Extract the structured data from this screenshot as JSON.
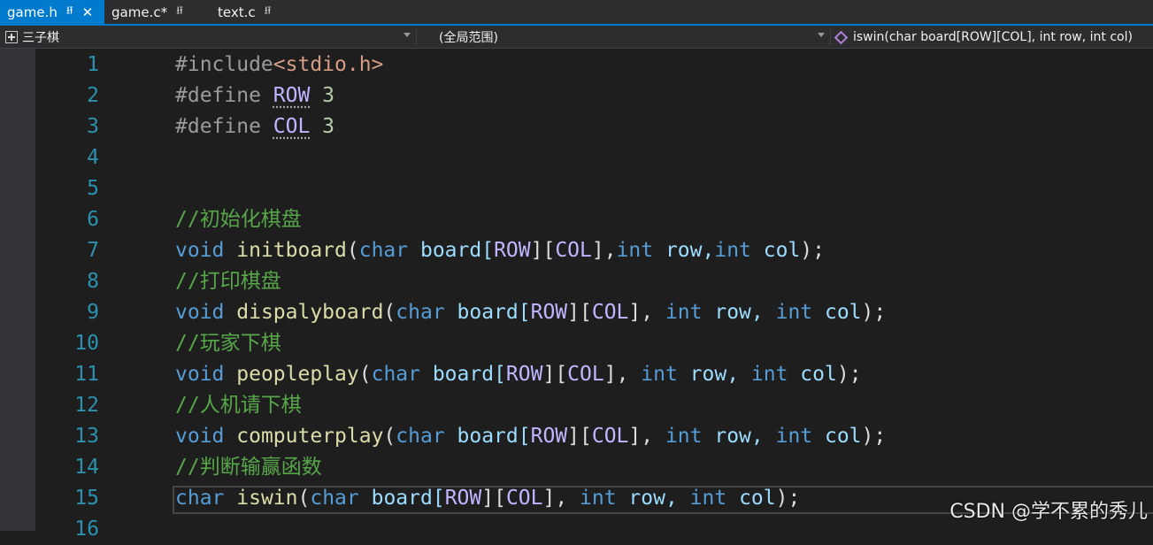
{
  "tabs": [
    {
      "label": "game.h",
      "pin": "⭿",
      "close": "✕",
      "active": true
    },
    {
      "label": "game.c*",
      "pin": "⭿",
      "active": false
    },
    {
      "label": "text.c",
      "pin": "⭿",
      "active": false
    }
  ],
  "nav": {
    "project": "三子棋",
    "scope": "(全局范围)",
    "member": "iswin(char board[ROW][COL], int row, int col)"
  },
  "editor": {
    "current_line": 15,
    "lines": [
      {
        "n": "1",
        "tokens": [
          {
            "t": "#include",
            "c": "pp"
          },
          {
            "t": "<stdio.h>",
            "c": "inc"
          }
        ]
      },
      {
        "n": "2",
        "tokens": [
          {
            "t": "#define ",
            "c": "pp"
          },
          {
            "t": "ROW",
            "c": "mac dot"
          },
          {
            "t": " 3",
            "c": "num"
          }
        ]
      },
      {
        "n": "3",
        "tokens": [
          {
            "t": "#define ",
            "c": "pp"
          },
          {
            "t": "COL",
            "c": "mac dot"
          },
          {
            "t": " 3",
            "c": "num"
          }
        ]
      },
      {
        "n": "4",
        "tokens": []
      },
      {
        "n": "5",
        "tokens": []
      },
      {
        "n": "6",
        "tokens": [
          {
            "t": "//初始化棋盘",
            "c": "cmt"
          }
        ]
      },
      {
        "n": "7",
        "tokens": [
          {
            "t": "void",
            "c": "kw"
          },
          {
            "t": " ",
            "c": "txt"
          },
          {
            "t": "initboard",
            "c": "fn"
          },
          {
            "t": "(",
            "c": "txt"
          },
          {
            "t": "char",
            "c": "kw"
          },
          {
            "t": " board[",
            "c": "par"
          },
          {
            "t": "ROW",
            "c": "mac"
          },
          {
            "t": "][",
            "c": "txt"
          },
          {
            "t": "COL",
            "c": "mac"
          },
          {
            "t": "],",
            "c": "txt"
          },
          {
            "t": "int",
            "c": "kw"
          },
          {
            "t": " row,",
            "c": "par"
          },
          {
            "t": "int",
            "c": "kw"
          },
          {
            "t": " col",
            "c": "par"
          },
          {
            "t": ");",
            "c": "txt"
          }
        ]
      },
      {
        "n": "8",
        "tokens": [
          {
            "t": "//打印棋盘",
            "c": "cmt"
          }
        ]
      },
      {
        "n": "9",
        "tokens": [
          {
            "t": "void",
            "c": "kw"
          },
          {
            "t": " ",
            "c": "txt"
          },
          {
            "t": "dispalyboard",
            "c": "fn"
          },
          {
            "t": "(",
            "c": "txt"
          },
          {
            "t": "char",
            "c": "kw"
          },
          {
            "t": " board[",
            "c": "par"
          },
          {
            "t": "ROW",
            "c": "mac"
          },
          {
            "t": "][",
            "c": "txt"
          },
          {
            "t": "COL",
            "c": "mac"
          },
          {
            "t": "], ",
            "c": "txt"
          },
          {
            "t": "int",
            "c": "kw"
          },
          {
            "t": " row, ",
            "c": "par"
          },
          {
            "t": "int",
            "c": "kw"
          },
          {
            "t": " col",
            "c": "par"
          },
          {
            "t": ");",
            "c": "txt"
          }
        ]
      },
      {
        "n": "10",
        "tokens": [
          {
            "t": "//玩家下棋",
            "c": "cmt"
          }
        ]
      },
      {
        "n": "11",
        "tokens": [
          {
            "t": "void",
            "c": "kw"
          },
          {
            "t": " ",
            "c": "txt"
          },
          {
            "t": "peopleplay",
            "c": "fn"
          },
          {
            "t": "(",
            "c": "txt"
          },
          {
            "t": "char",
            "c": "kw"
          },
          {
            "t": " board[",
            "c": "par"
          },
          {
            "t": "ROW",
            "c": "mac"
          },
          {
            "t": "][",
            "c": "txt"
          },
          {
            "t": "COL",
            "c": "mac"
          },
          {
            "t": "], ",
            "c": "txt"
          },
          {
            "t": "int",
            "c": "kw"
          },
          {
            "t": " row, ",
            "c": "par"
          },
          {
            "t": "int",
            "c": "kw"
          },
          {
            "t": " col",
            "c": "par"
          },
          {
            "t": ");",
            "c": "txt"
          }
        ]
      },
      {
        "n": "12",
        "tokens": [
          {
            "t": "//人机请下棋",
            "c": "cmt"
          }
        ]
      },
      {
        "n": "13",
        "tokens": [
          {
            "t": "void",
            "c": "kw"
          },
          {
            "t": " ",
            "c": "txt"
          },
          {
            "t": "computerplay",
            "c": "fn"
          },
          {
            "t": "(",
            "c": "txt"
          },
          {
            "t": "char",
            "c": "kw"
          },
          {
            "t": " board[",
            "c": "par"
          },
          {
            "t": "ROW",
            "c": "mac"
          },
          {
            "t": "][",
            "c": "txt"
          },
          {
            "t": "COL",
            "c": "mac"
          },
          {
            "t": "], ",
            "c": "txt"
          },
          {
            "t": "int",
            "c": "kw"
          },
          {
            "t": " row, ",
            "c": "par"
          },
          {
            "t": "int",
            "c": "kw"
          },
          {
            "t": " col",
            "c": "par"
          },
          {
            "t": ");",
            "c": "txt"
          }
        ]
      },
      {
        "n": "14",
        "tokens": [
          {
            "t": "//判断输赢函数",
            "c": "cmt"
          }
        ]
      },
      {
        "n": "15",
        "tokens": [
          {
            "t": "char",
            "c": "kw"
          },
          {
            "t": " ",
            "c": "txt"
          },
          {
            "t": "iswin",
            "c": "fn"
          },
          {
            "t": "(",
            "c": "txt"
          },
          {
            "t": "char",
            "c": "kw"
          },
          {
            "t": " board[",
            "c": "par"
          },
          {
            "t": "ROW",
            "c": "mac"
          },
          {
            "t": "][",
            "c": "txt"
          },
          {
            "t": "COL",
            "c": "mac"
          },
          {
            "t": "], ",
            "c": "txt"
          },
          {
            "t": "int",
            "c": "kw"
          },
          {
            "t": " row, ",
            "c": "par"
          },
          {
            "t": "int",
            "c": "kw"
          },
          {
            "t": " col",
            "c": "par"
          },
          {
            "t": ");",
            "c": "txt"
          }
        ]
      },
      {
        "n": "16",
        "tokens": []
      }
    ]
  },
  "watermark": "CSDN @学不累的秀儿",
  "colors": {
    "accent": "#007acc",
    "keyword": "#569cd6",
    "function": "#dcdcaa",
    "macro": "#beb7ff",
    "comment": "#57a64a",
    "line_number": "#2b91af",
    "include_path": "#d69d85",
    "number": "#b5cea8"
  }
}
